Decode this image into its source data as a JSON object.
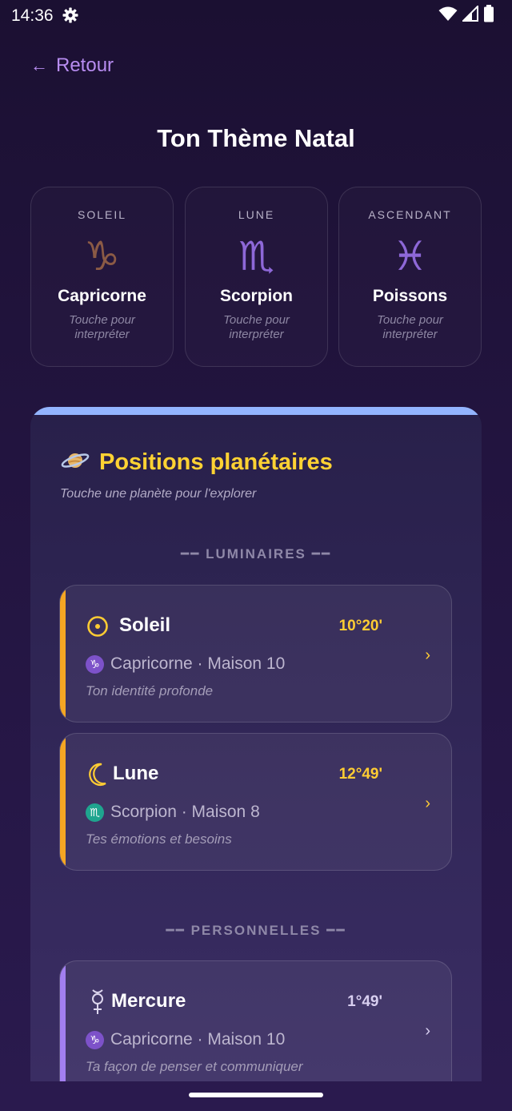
{
  "status_bar": {
    "time": "14:36",
    "icons": [
      "gear-icon",
      "wifi-icon",
      "cell-signal-icon",
      "battery-icon"
    ]
  },
  "nav": {
    "back_arrow": "←",
    "back_label": "Retour"
  },
  "page": {
    "title": "Ton Thème Natal"
  },
  "signs": [
    {
      "label": "SOLEIL",
      "glyph": "♑",
      "glyph_color": "#8b5a45",
      "name": "Capricorne",
      "hint": "Touche pour interpréter"
    },
    {
      "label": "LUNE",
      "glyph": "♏",
      "glyph_color": "#8e68d8",
      "name": "Scorpion",
      "hint": "Touche pour interpréter"
    },
    {
      "label": "ASCENDANT",
      "glyph": "♓",
      "glyph_color": "#8e68d8",
      "name": "Poissons",
      "hint": "Touche pour interpréter"
    }
  ],
  "planets_panel": {
    "icon": "ringed-planet-icon",
    "title": "Positions planétaires",
    "subtitle": "Touche une planète pour l'explorer",
    "sections": [
      {
        "label": "━━ LUMINAIRES ━━"
      },
      {
        "label": "━━ PERSONNELLES ━━"
      }
    ],
    "planets": [
      {
        "symbol": "sun-icon",
        "name": "Soleil",
        "degree": "10°20'",
        "sign_glyph": "♑",
        "sign_badge_color": "#7d52c9",
        "sign_text": "Capricorne · Maison 10",
        "description": "Ton identité profonde",
        "accent_color": "#f5a623",
        "chevron": "›"
      },
      {
        "symbol": "moon-icon",
        "name": "Lune",
        "degree": "12°49'",
        "sign_glyph": "♏",
        "sign_badge_color": "#1fa58f",
        "sign_text": "Scorpion · Maison 8",
        "description": "Tes émotions et besoins",
        "accent_color": "#f5a623",
        "chevron": "›"
      },
      {
        "symbol": "mercury-icon",
        "name": "Mercure",
        "degree": "1°49'",
        "sign_glyph": "♑",
        "sign_badge_color": "#7d52c9",
        "sign_text": "Capricorne · Maison 10",
        "description": "Ta façon de penser et communiquer",
        "accent_color": "#a27ff0",
        "chevron": "›"
      }
    ]
  },
  "colors": {
    "accent_gold": "#ffd233",
    "accent_purple": "#b78cf0",
    "panel_top": "#93b4ff"
  }
}
